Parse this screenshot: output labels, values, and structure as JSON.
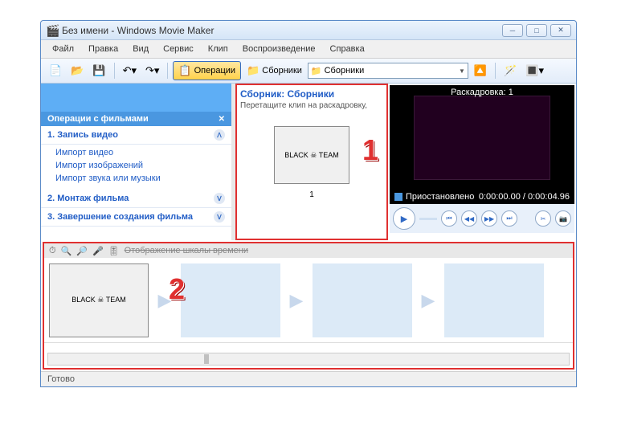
{
  "title": "Без имени - Windows Movie Maker",
  "menu": [
    "Файл",
    "Правка",
    "Вид",
    "Сервис",
    "Клип",
    "Воспроизведение",
    "Справка"
  ],
  "toolbar": {
    "operations": "Операции",
    "collections": "Сборники",
    "collection_dd": "Сборники"
  },
  "tasks": {
    "header": "Операции с фильмами",
    "g1": {
      "title": "1. Запись видео",
      "links": [
        "Импорт видео",
        "Импорт изображений",
        "Импорт звука или музыки"
      ]
    },
    "g2": {
      "title": "2. Монтаж фильма"
    },
    "g3": {
      "title": "3. Завершение создания фильма"
    }
  },
  "collection": {
    "title": "Сборник: Сборники",
    "sub": "Перетащите клип на раскадровку,",
    "thumb_label": "1"
  },
  "preview": {
    "title": "Раскадровка: 1",
    "state": "Приостановлено",
    "time": "0:00:00.00 / 0:00:04.96"
  },
  "timeline": {
    "toolbar": "Отображение шкалы времени"
  },
  "status": "Готово",
  "callouts": {
    "one": "1",
    "two": "2"
  },
  "clip_art": "BLACK ☠ TEAM"
}
